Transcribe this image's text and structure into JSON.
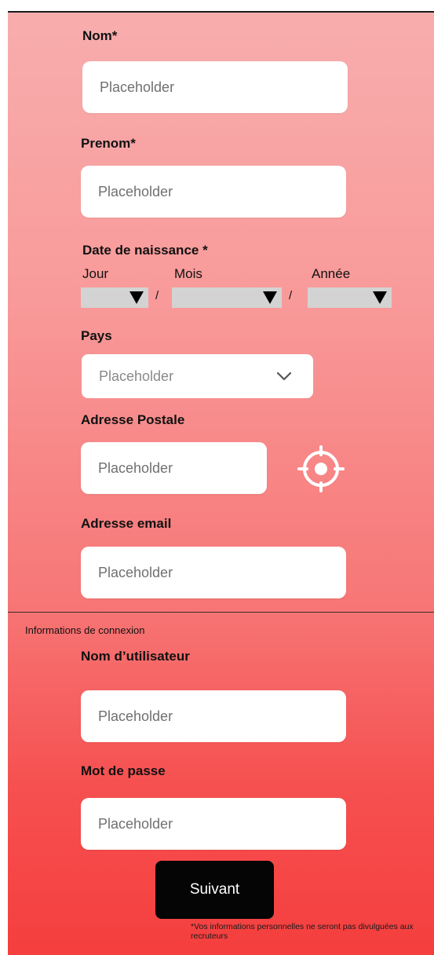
{
  "form": {
    "nom": {
      "label": "Nom*",
      "placeholder": "Placeholder"
    },
    "prenom": {
      "label": "Prenom*",
      "placeholder": "Placeholder"
    },
    "date_naissance": {
      "label": "Date de naissance *",
      "jour_label": "Jour",
      "mois_label": "Mois",
      "annee_label": "Année",
      "separator": "/"
    },
    "pays": {
      "label": "Pays",
      "placeholder": "Placeholder"
    },
    "adresse_postale": {
      "label": "Adresse Postale",
      "placeholder": "Placeholder"
    },
    "adresse_email": {
      "label": "Adresse email",
      "placeholder": "Placeholder"
    }
  },
  "connexion": {
    "section_title": "Informations de connexion",
    "nom_utilisateur": {
      "label": "Nom d’utilisateur",
      "placeholder": "Placeholder"
    },
    "mot_de_passe": {
      "label": "Mot de passe",
      "placeholder": "Placeholder"
    }
  },
  "actions": {
    "next_label": "Suivant"
  },
  "footer": {
    "note": "*Vos informations personnelles ne seront pas divulguées aux recruteurs"
  },
  "icons": {
    "locate": "target-crosshair-icon",
    "chevron": "chevron-down-icon",
    "dropdown_arrow": "triangle-down-icon"
  },
  "colors": {
    "gradient_top": "#f8adad",
    "gradient_bottom": "#f53e3e",
    "button": "#050505"
  }
}
